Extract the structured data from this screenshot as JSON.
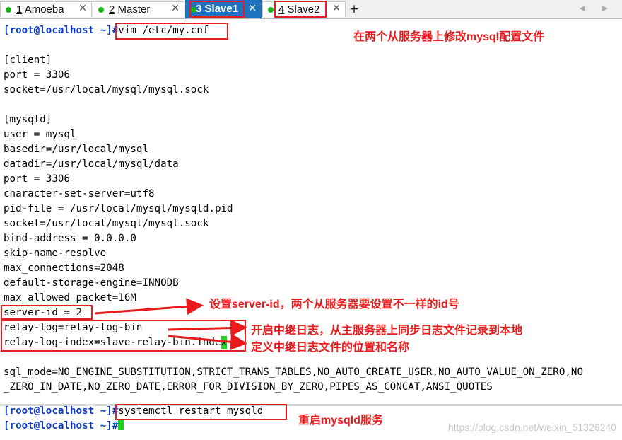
{
  "tabs": [
    {
      "number": "1",
      "name": "Amoeba"
    },
    {
      "number": "2",
      "name": "Master"
    },
    {
      "number": "3",
      "name": "Slave1"
    },
    {
      "number": "4",
      "name": "Slave2"
    }
  ],
  "tab_close_glyph": "✕",
  "new_tab_glyph": "+",
  "scroll_glyphs": "◀ ▶",
  "terminal": {
    "prompt": "[root@localhost ~]#",
    "command_vim": "vim /etc/my.cnf",
    "config_lines": [
      "[client]",
      "port = 3306",
      "socket=/usr/local/mysql/mysql.sock",
      "",
      "[mysqld]",
      "user = mysql",
      "basedir=/usr/local/mysql",
      "datadir=/usr/local/mysql/data",
      "port = 3306",
      "character-set-server=utf8",
      "pid-file = /usr/local/mysql/mysqld.pid",
      "socket=/usr/local/mysql/mysql.sock",
      "bind-address = 0.0.0.0",
      "skip-name-resolve",
      "max_connections=2048",
      "default-storage-engine=INNODB",
      "max_allowed_packet=16M",
      "server-id = 2",
      "relay-log=relay-log-bin",
      "relay-log-index=slave-relay-bin.inde"
    ],
    "cursor_char": "x",
    "sql_mode_line1": "sql_mode=NO_ENGINE_SUBSTITUTION,STRICT_TRANS_TABLES,NO_AUTO_CREATE_USER,NO_AUTO_VALUE_ON_ZERO,NO",
    "sql_mode_line2": "_ZERO_IN_DATE,NO_ZERO_DATE,ERROR_FOR_DIVISION_BY_ZERO,PIPES_AS_CONCAT,ANSI_QUOTES",
    "command_restart": "systemctl restart mysqld"
  },
  "annotations": {
    "edit_config": "在两个从服务器上修改mysql配置文件",
    "server_id": "设置server-id，两个从服务器要设置不一样的id号",
    "relay_log": "开启中继日志，从主服务器上同步日志文件记录到本地",
    "relay_log_index": "定义中继日志文件的位置和名称",
    "restart": "重启mysqld服务"
  },
  "watermark": "https://blog.csdn.net/weixin_51326240",
  "colors": {
    "annotation_red": "#e81c1c",
    "prompt_blue": "#0a3cc8",
    "active_tab": "#1e73be",
    "cursor_green": "#1ed21e",
    "status_dot": "#18b418"
  }
}
